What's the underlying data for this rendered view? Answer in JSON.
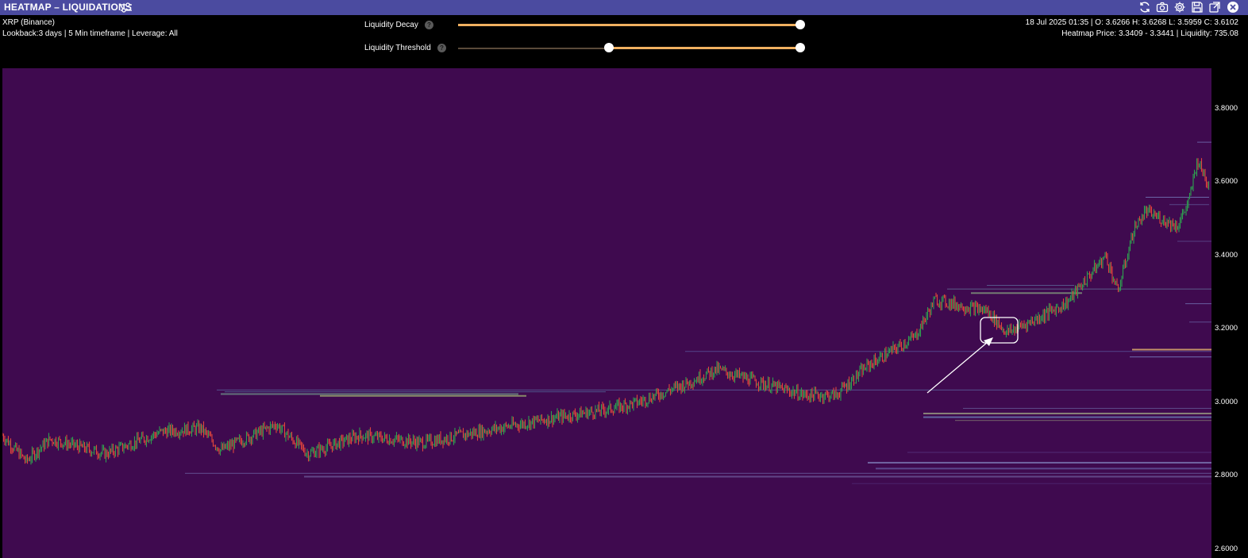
{
  "titlebar": {
    "title": "HEATMAP – LIQUIDATIONS",
    "icons": [
      "refresh-icon",
      "camera-icon",
      "gear-icon",
      "save-icon",
      "external-link-icon",
      "close-icon"
    ],
    "bg_color": "#4b4ba0"
  },
  "info": {
    "symbol": "XRP (Binance)",
    "lookback": "Lookback:3 days | 5 Min timeframe | Leverage: All"
  },
  "controls": {
    "decay_label": "Liquidity Decay",
    "decay_value": 1.0,
    "threshold_label": "Liquidity Threshold",
    "threshold_range": [
      0.44,
      1.0
    ],
    "help_glyph": "?"
  },
  "ohlc": {
    "line1": "18 Jul 2025 01:35 | O: 3.6266 H: 3.6268 L: 3.5959 C: 3.6102",
    "line2": "Heatmap Price: 3.3409 - 3.3441 | Liquidity: 735.08"
  },
  "axis": {
    "ticks": [
      "3.8000",
      "3.6000",
      "3.4000",
      "3.2000",
      "3.0000",
      "2.8000",
      "2.6000"
    ],
    "values": [
      3.8,
      3.6,
      3.4,
      3.2,
      3.0,
      2.8,
      2.6
    ]
  },
  "colors": {
    "heatmap_bg": "#3f0a4f",
    "slider_fill": "#f0b060",
    "candle_up": "#2e9e4f",
    "candle_down": "#e0453c"
  }
}
